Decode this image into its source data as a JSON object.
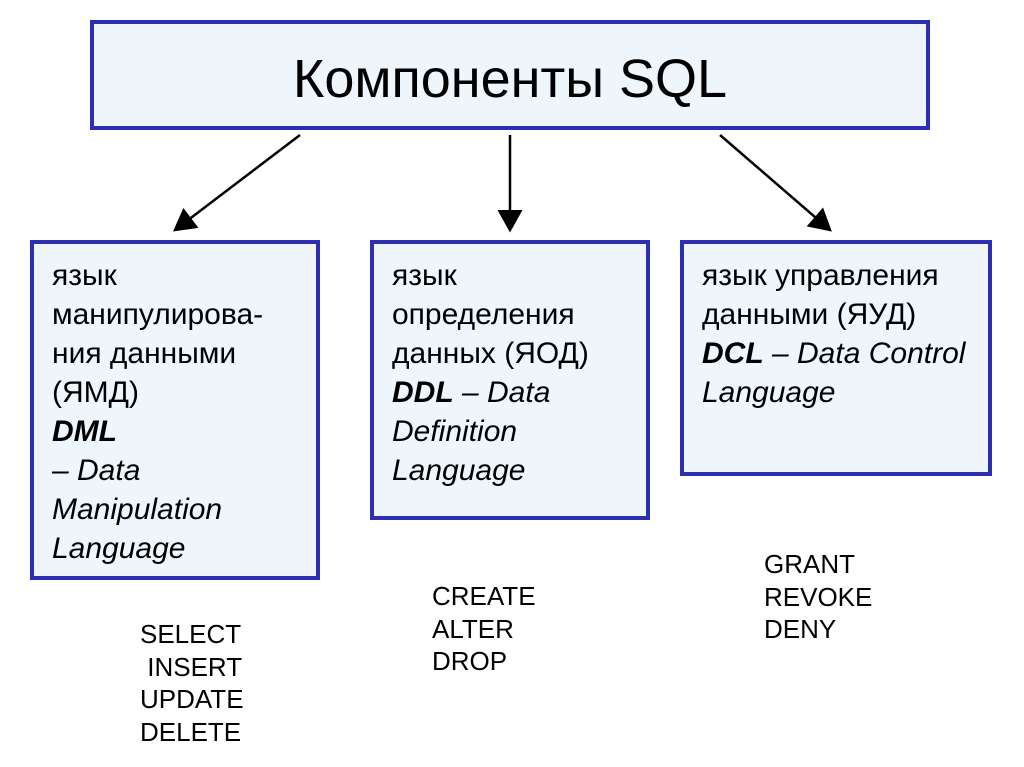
{
  "title": "Компоненты SQL",
  "boxes": {
    "dml": {
      "line1": "язык",
      "line2": "манипулирова-",
      "line3": "ния данными",
      "line4": "(ЯМД)",
      "abbr": "DML",
      "expansion": " – Data Manipulation Language",
      "commands": "SELECT\n INSERT\nUPDATE\nDELETE"
    },
    "ddl": {
      "line1": "язык",
      "line2": "определения",
      "line3": "данных (ЯОД)",
      "abbr": "DDL",
      "expansion": " – Data Definition Language",
      "commands": "CREATE\nALTER\nDROP"
    },
    "dcl": {
      "line1": "язык управления",
      "line2": "данными (ЯУД)",
      "abbr": "DCL",
      "expansion": " – Data Control Language",
      "commands": "GRANT\nREVOKE\nDENY"
    }
  },
  "chart_data": {
    "type": "diagram",
    "root": "Компоненты SQL",
    "children": [
      {
        "name": "DML",
        "full": "Data Manipulation Language",
        "ru": "язык манипулирования данными (ЯМД)",
        "commands": [
          "SELECT",
          "INSERT",
          "UPDATE",
          "DELETE"
        ]
      },
      {
        "name": "DDL",
        "full": "Data Definition Language",
        "ru": "язык определения данных (ЯОД)",
        "commands": [
          "CREATE",
          "ALTER",
          "DROP"
        ]
      },
      {
        "name": "DCL",
        "full": "Data Control Language",
        "ru": "язык управления данными (ЯУД)",
        "commands": [
          "GRANT",
          "REVOKE",
          "DENY"
        ]
      }
    ]
  }
}
